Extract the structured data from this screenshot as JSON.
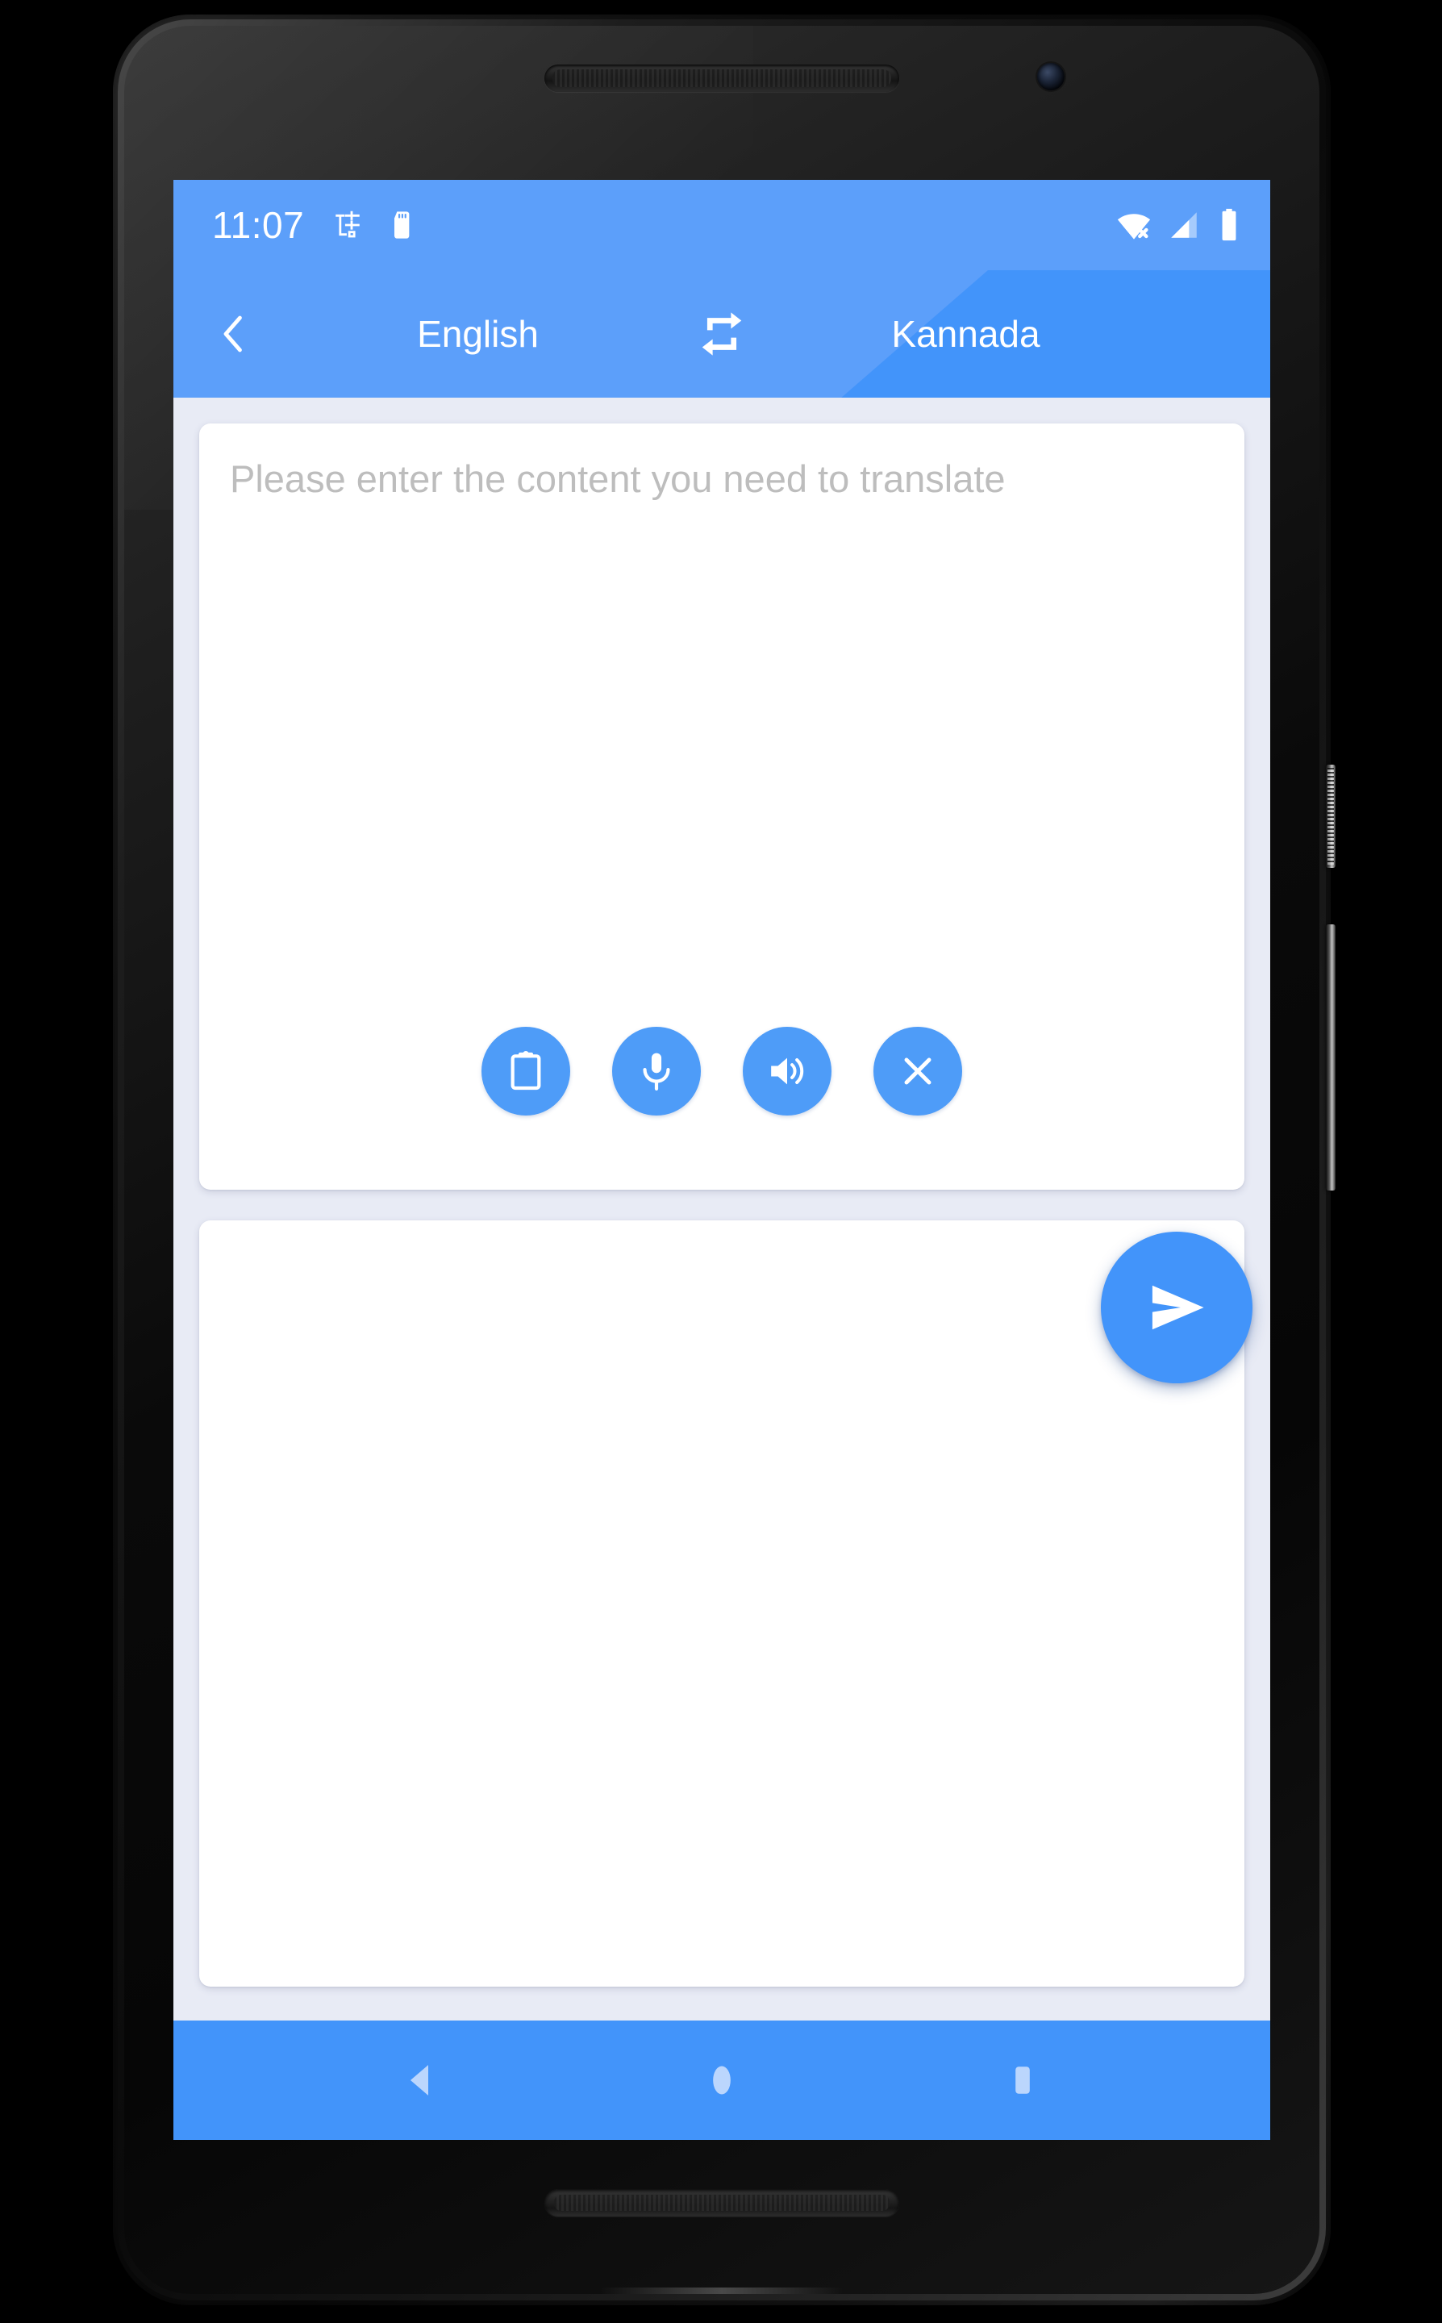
{
  "statusbar": {
    "time": "11:07",
    "icons_left": [
      "usb-transfer-icon",
      "sd-card-icon"
    ],
    "icons_right": [
      "wifi-off-icon",
      "cellular-signal-icon",
      "battery-full-icon"
    ]
  },
  "appbar": {
    "back_icon": "chevron-left-icon",
    "source_language": "English",
    "swap_icon": "swap-horizontal-icon",
    "target_language": "Kannada"
  },
  "input_card": {
    "placeholder": "Please enter the content you need to translate",
    "value": "",
    "actions": [
      {
        "name": "paste-button",
        "icon": "clipboard-icon"
      },
      {
        "name": "voice-input-button",
        "icon": "microphone-icon"
      },
      {
        "name": "speak-button",
        "icon": "speaker-icon"
      },
      {
        "name": "clear-button",
        "icon": "close-icon"
      }
    ]
  },
  "output_card": {
    "value": ""
  },
  "fab": {
    "name": "translate-send-button",
    "icon": "send-icon"
  },
  "navbar": {
    "back": "back-triangle-icon",
    "home": "home-circle-icon",
    "recents": "recents-square-icon"
  },
  "colors": {
    "primary": "#4294FA",
    "primary_light": "#5C9FFA",
    "accent_button": "#4E9CF8",
    "background": "#E8EBF5",
    "card": "#FFFFFF",
    "placeholder_text": "#BDBDBD",
    "nav_icon": "#BBD6FD"
  }
}
